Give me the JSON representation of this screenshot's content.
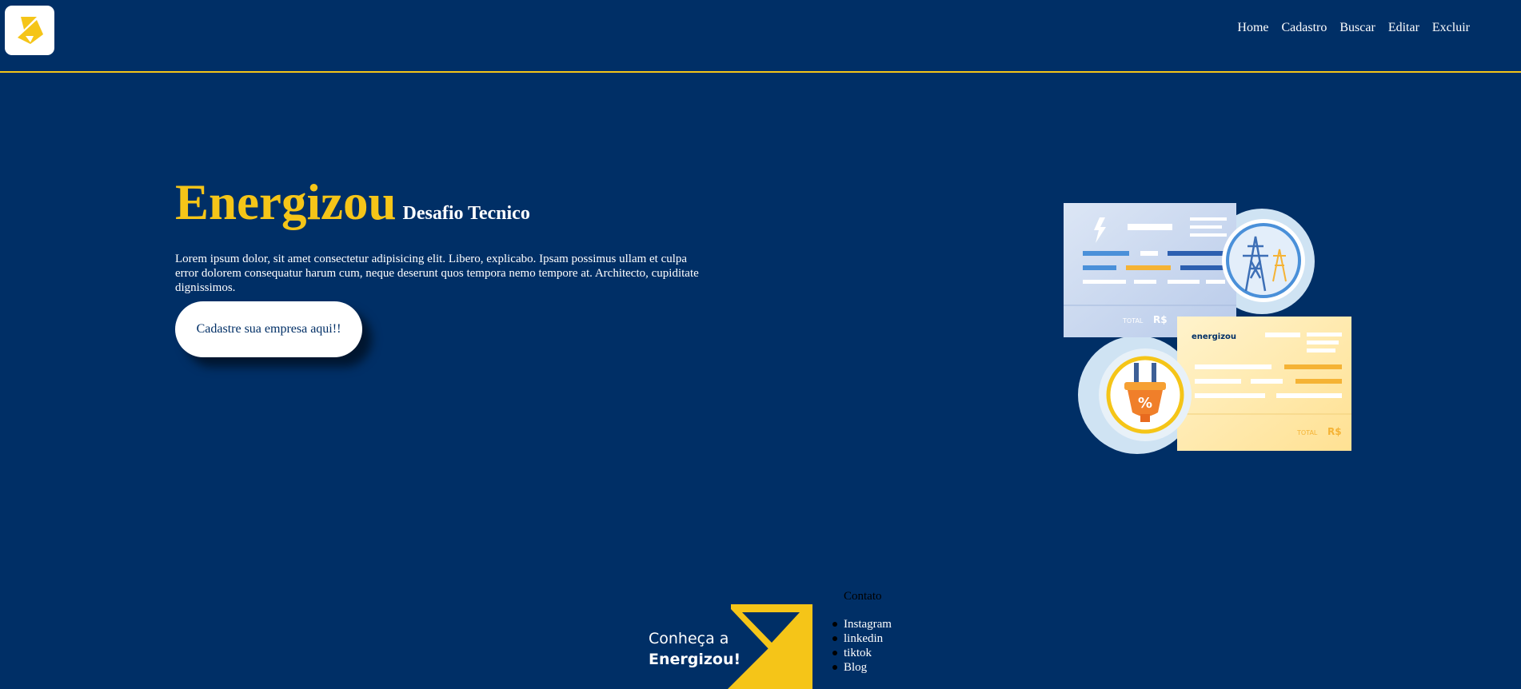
{
  "header": {
    "logo_icon": "energizou-logo-icon",
    "nav": [
      {
        "label": "Home"
      },
      {
        "label": "Cadastro"
      },
      {
        "label": "Buscar"
      },
      {
        "label": "Editar"
      },
      {
        "label": "Excluir"
      }
    ]
  },
  "hero": {
    "brand": "Energizou",
    "subtitle": "Desafio Tecnico",
    "description": "Lorem ipsum dolor, sit amet consectetur adipisicing elit. Libero, explicabo. Ipsam possimus ullam et culpa error dolorem consequatur harum cum, neque deserunt quos tempora nemo tempore at. Architecto, cupiditate dignissimos.",
    "cta_label": "Cadastre sua empresa aqui!!"
  },
  "illustration": {
    "bill_total_label": "TOTAL",
    "bill_currency": "R$",
    "bill_brand": "energizou"
  },
  "footer": {
    "promo_line1": "Conheça a",
    "promo_line2": "Energizou!",
    "contact_title": "Contato",
    "links": [
      {
        "label": "Instagram"
      },
      {
        "label": "linkedin"
      },
      {
        "label": "tiktok"
      },
      {
        "label": "Blog"
      }
    ]
  },
  "colors": {
    "background": "#002f66",
    "accent": "#f5c518",
    "text": "#ffffff"
  }
}
